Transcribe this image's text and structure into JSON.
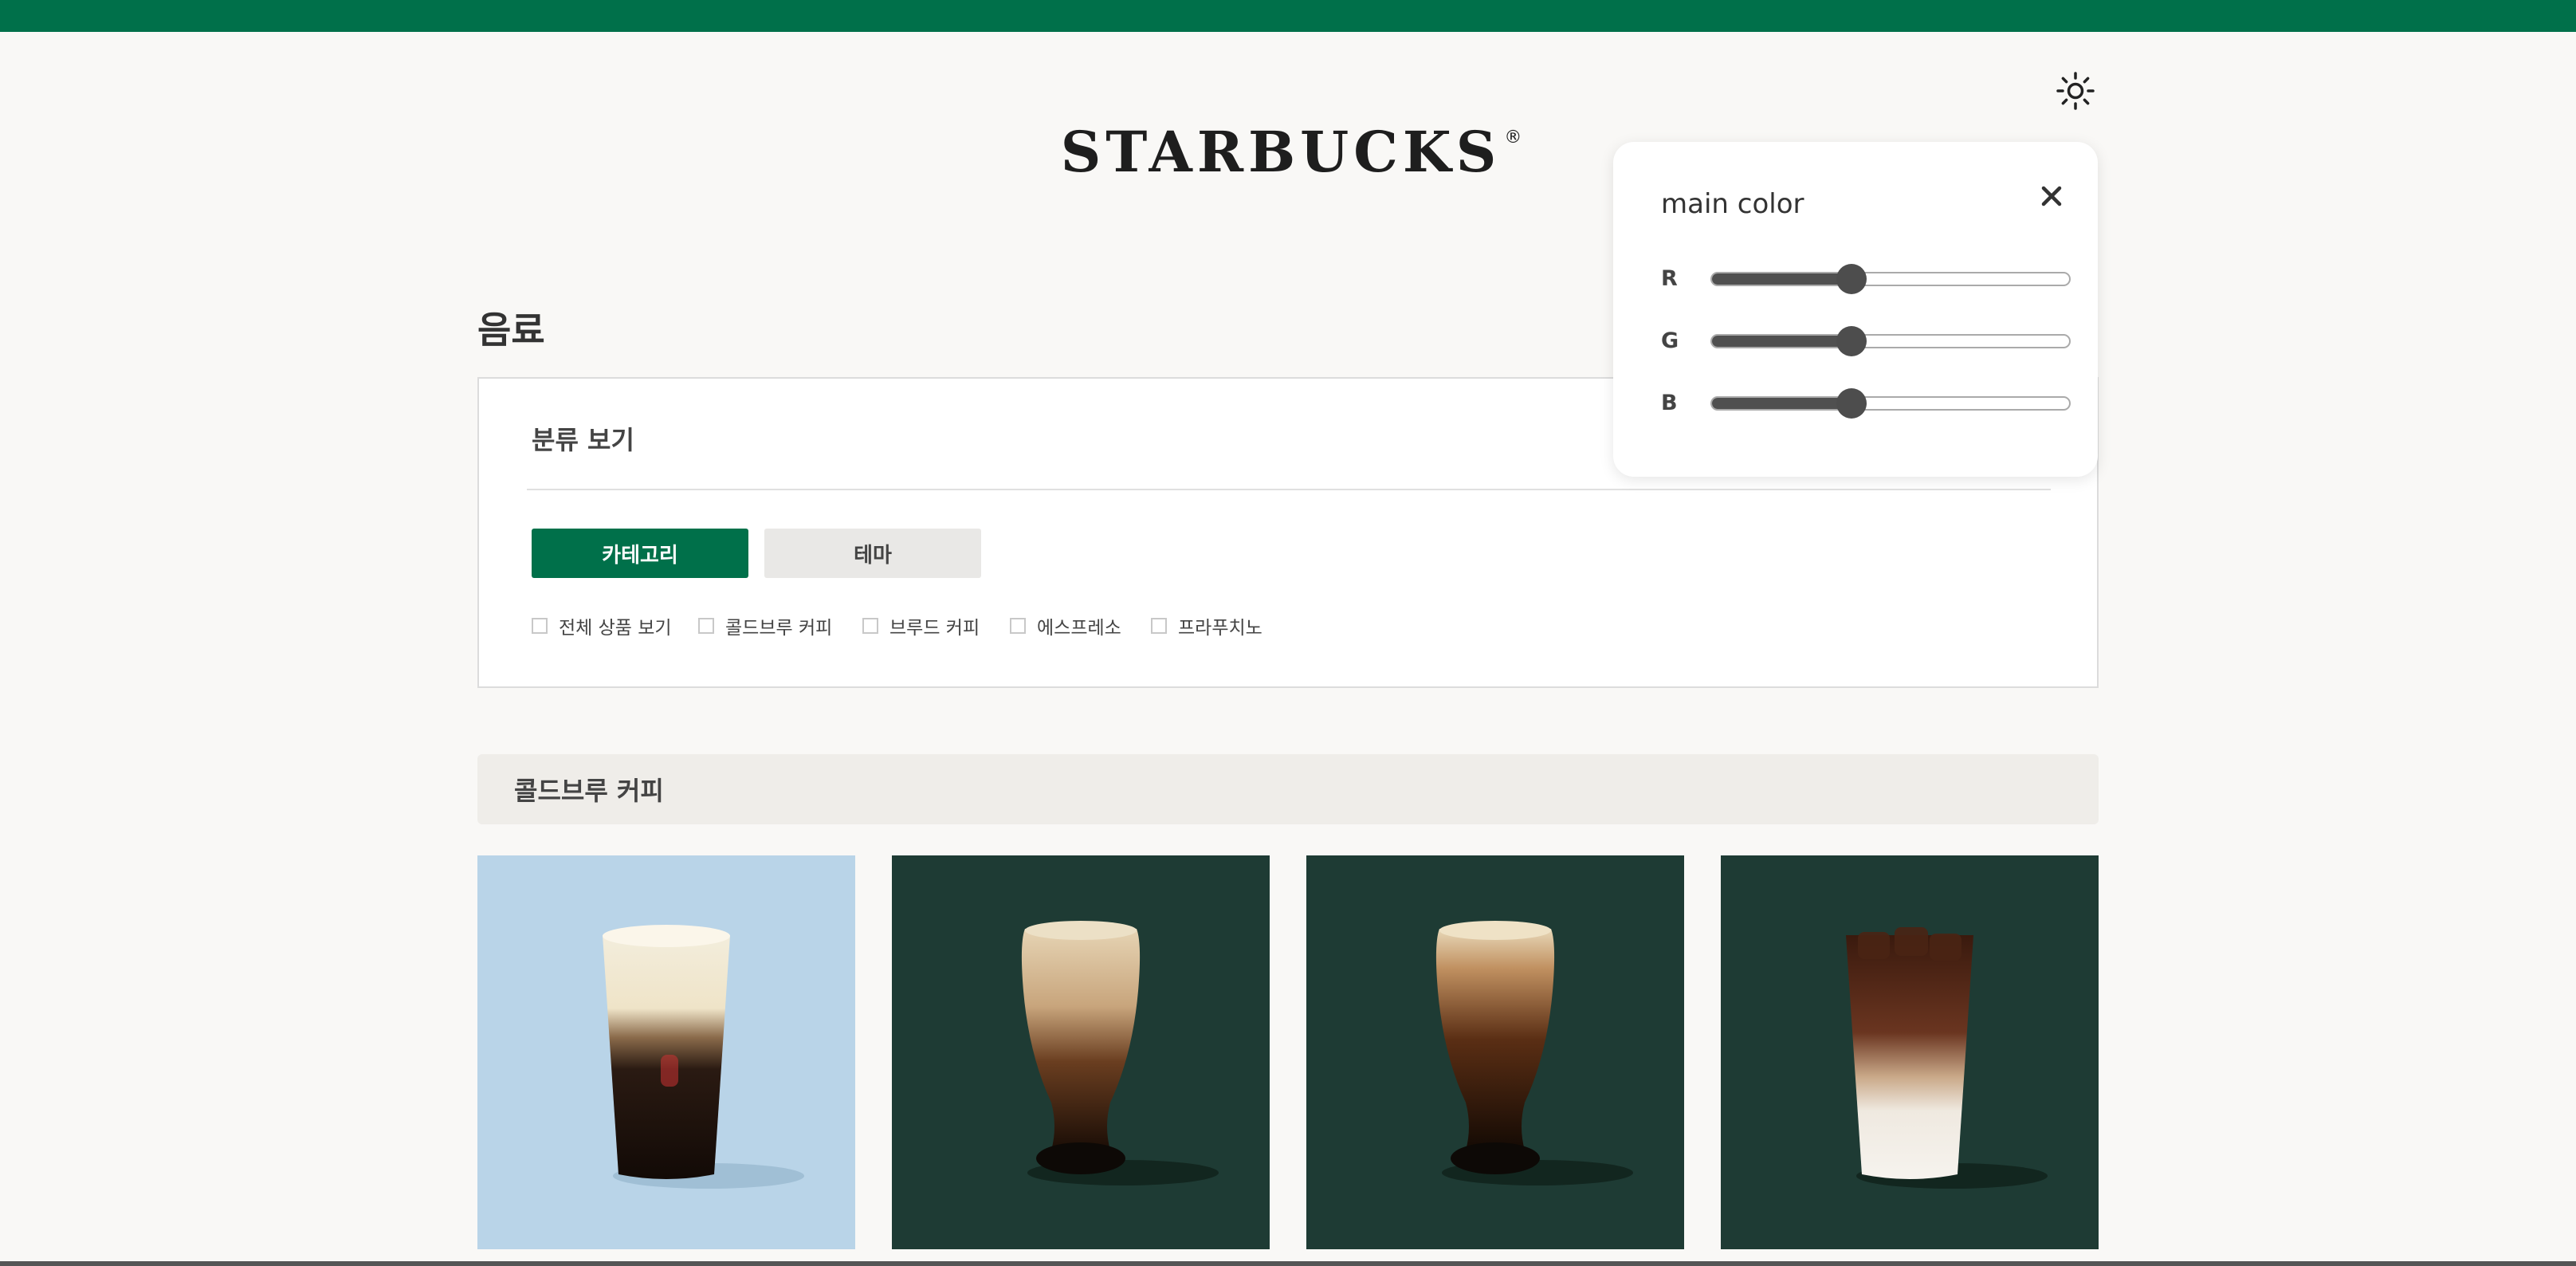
{
  "header": {
    "logo_text": "STARBUCKS",
    "logo_reg": "®",
    "theme_icon": "sun-icon"
  },
  "page": {
    "title": "음료"
  },
  "filter": {
    "heading": "분류 보기",
    "tabs": [
      {
        "label": "카테고리",
        "active": true
      },
      {
        "label": "테마",
        "active": false
      }
    ],
    "checkboxes": [
      {
        "label": "전체 상품 보기",
        "checked": false
      },
      {
        "label": "콜드브루 커피",
        "checked": false
      },
      {
        "label": "브루드 커피",
        "checked": false
      },
      {
        "label": "에스프레소",
        "checked": false
      },
      {
        "label": "프라푸치노",
        "checked": false
      }
    ]
  },
  "section": {
    "title": "콜드브루 커피"
  },
  "products": [
    {
      "name": "product-1",
      "background": "#b9d4e8"
    },
    {
      "name": "product-2",
      "background": "#1e3b34"
    },
    {
      "name": "product-3",
      "background": "#1e3b34"
    },
    {
      "name": "product-4",
      "background": "#1e3b34"
    }
  ],
  "color_panel": {
    "title": "main color",
    "close_icon": "close-icon",
    "sliders": [
      {
        "label": "R",
        "value_fraction": 0.39
      },
      {
        "label": "G",
        "value_fraction": 0.39
      },
      {
        "label": "B",
        "value_fraction": 0.39
      }
    ]
  },
  "colors": {
    "brand_green": "#00704a",
    "background": "#f9f8f6",
    "section_bg": "#efede9"
  }
}
